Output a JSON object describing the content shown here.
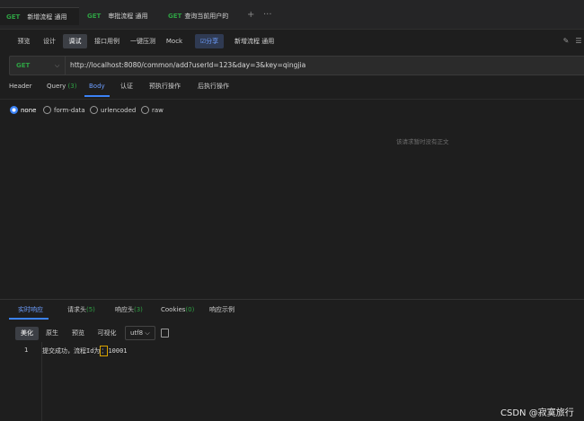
{
  "tabs": [
    {
      "method": "GET",
      "title": "新增流程 通用"
    },
    {
      "method": "GET",
      "title": "审批流程 通用"
    },
    {
      "method": "GET",
      "title": "查询当前用户的"
    }
  ],
  "toolbar": {
    "modes": [
      "预览",
      "设计",
      "调试",
      "接口用例",
      "一键压测",
      "Mock"
    ],
    "active_mode": "调试",
    "share_label": "☑分享",
    "title": "新增流程 通用"
  },
  "request": {
    "method": "GET",
    "url": "http://localhost:8080/common/add?userId=123&day=3&key=qingjia"
  },
  "request_tabs": {
    "header": "Header",
    "query": "Query",
    "query_count": "(3)",
    "body": "Body",
    "auth": "认证",
    "pre": "预执行操作",
    "post": "后执行操作"
  },
  "body_types": [
    "none",
    "form-data",
    "urlencoded",
    "raw"
  ],
  "body_empty_text": "该请求暂时没有正文",
  "response_tabs": {
    "realtime": "实时响应",
    "req_headers": "请求头",
    "req_headers_count": "(5)",
    "resp_headers": "响应头",
    "resp_headers_count": "(3)",
    "cookies": "Cookies",
    "cookies_count": "(0)",
    "example": "响应示例"
  },
  "format_buttons": [
    "美化",
    "原生",
    "预览",
    "可视化"
  ],
  "encoding": "utf8",
  "response_line_number": "1",
  "response_text_before": "提交成功，流程Id为",
  "response_text_cursor": "：",
  "response_text_after": "10001",
  "watermark": "CSDN @寂寞旅行",
  "colors": {
    "method_green": "#2ea043",
    "accent_blue": "#3b82f6"
  }
}
